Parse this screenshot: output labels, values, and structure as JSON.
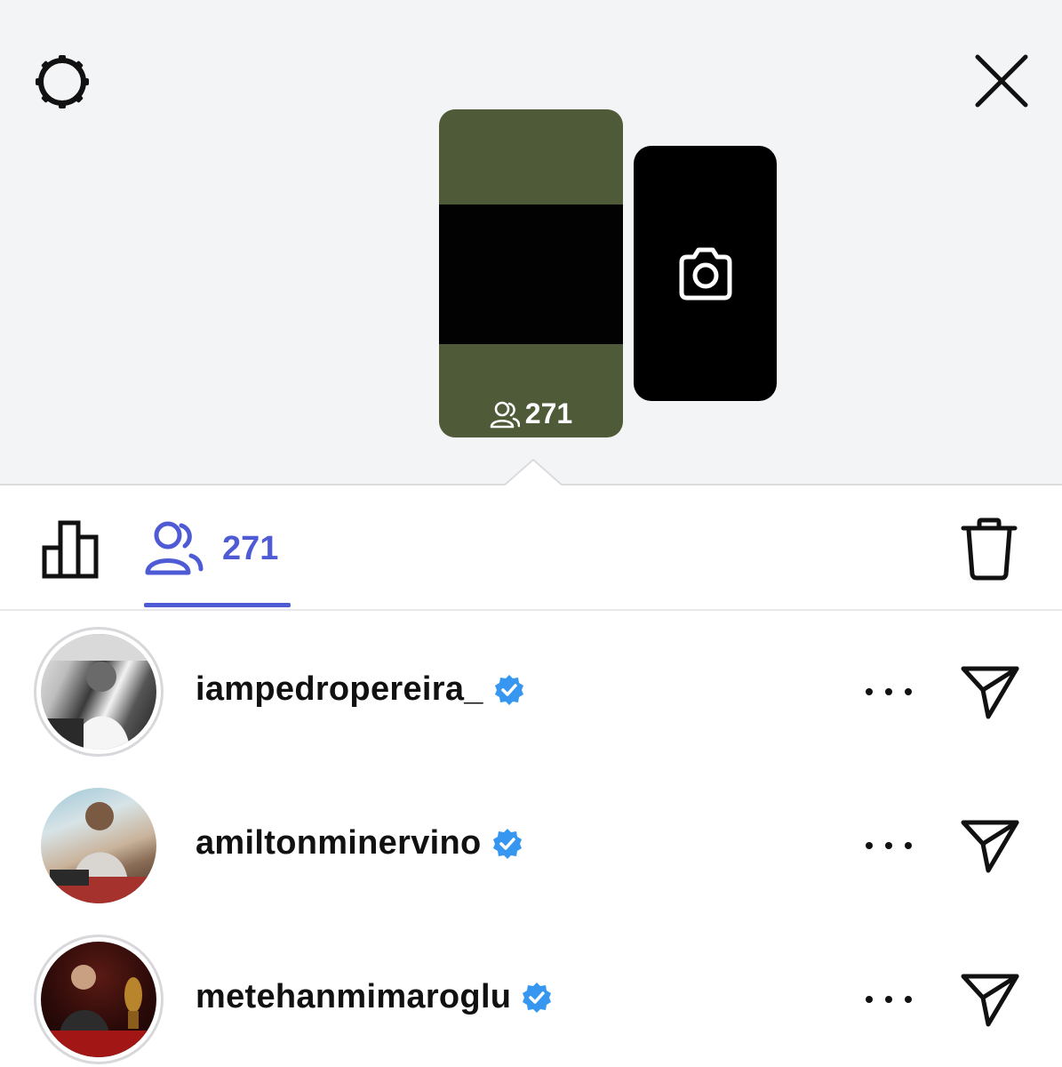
{
  "header": {
    "settings_icon": "gear-icon",
    "close_icon": "close-icon"
  },
  "story": {
    "thumbnail_colors": {
      "top": "#4f5a38",
      "band": "#020202"
    },
    "viewer_count": "271",
    "viewer_icon": "people-icon",
    "add_icon": "camera-icon"
  },
  "tabs": {
    "insights_icon": "bar-chart-icon",
    "viewers_icon": "people-icon",
    "viewers_count": "271",
    "accent_color": "#4f5bd5",
    "delete_icon": "trash-icon"
  },
  "viewers": [
    {
      "username": "iampedropereira_",
      "verified": true,
      "more_icon": "more-icon",
      "send_icon": "send-icon"
    },
    {
      "username": "amiltonminervino",
      "verified": true,
      "more_icon": "more-icon",
      "send_icon": "send-icon"
    },
    {
      "username": "metehanmimaroglu",
      "verified": true,
      "more_icon": "more-icon",
      "send_icon": "send-icon"
    }
  ],
  "colors": {
    "verified_badge": "#3797f0",
    "top_background": "#f3f4f6"
  }
}
